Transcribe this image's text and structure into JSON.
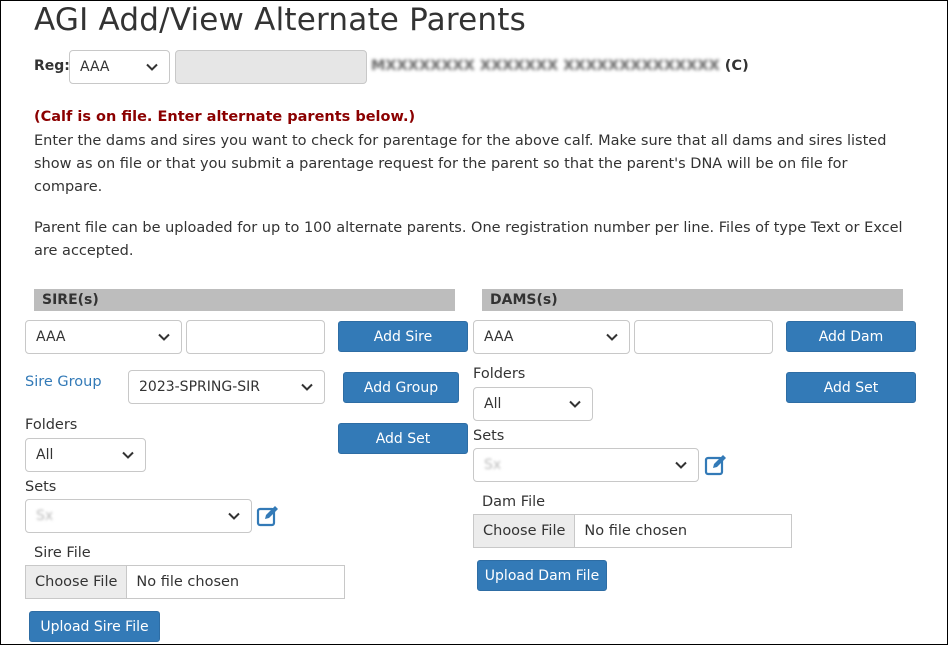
{
  "page": {
    "title": "AGI Add/View Alternate Parents"
  },
  "reg": {
    "label": "Reg:",
    "breed_value": "AAA",
    "calf_name_obscured": "MXXXXXXXX XXXXXXX XXXXXXXXXXXXXX",
    "calf_suffix": "(C)"
  },
  "notice": "(Calf is on file. Enter alternate parents below.)",
  "instructions": [
    "Enter the dams and sires you want to check for parentage for the above calf. Make sure that all dams and sires listed",
    "show as on file or that you submit a parentage request for the parent so that the parent's DNA will be on file for",
    "compare.",
    "Parent file can be uploaded for up to 100 alternate parents. One registration number per line. Files of type Text or Excel",
    "are accepted."
  ],
  "sires": {
    "header": "SIRE(s)",
    "breed_value": "AAA",
    "add_button": "Add Sire",
    "group_label": "Sire Group",
    "group_value": "2023-SPRING-SIR",
    "add_group_button": "Add Group",
    "folders_label": "Folders",
    "folders_value": "All",
    "add_set_button": "Add Set",
    "sets_label": "Sets",
    "sets_value_obscured": "Sx",
    "file_label": "Sire File",
    "choose_file": "Choose File",
    "no_file": "No file chosen",
    "upload_button": "Upload Sire File"
  },
  "dams": {
    "header": "DAMS(s)",
    "breed_value": "AAA",
    "add_button": "Add Dam",
    "folders_label": "Folders",
    "folders_value": "All",
    "add_set_button": "Add Set",
    "sets_label": "Sets",
    "sets_value_obscured": "Sx",
    "file_label": "Dam File",
    "choose_file": "Choose File",
    "no_file": "No file chosen",
    "upload_button": "Upload Dam File"
  },
  "colors": {
    "primary_button": "#337ab7",
    "notice": "#8b0000",
    "section_bar": "#bdbdbd",
    "link": "#337ab7"
  },
  "icons": {
    "dropdown": "chevron-down-icon",
    "edit": "edit-icon"
  }
}
